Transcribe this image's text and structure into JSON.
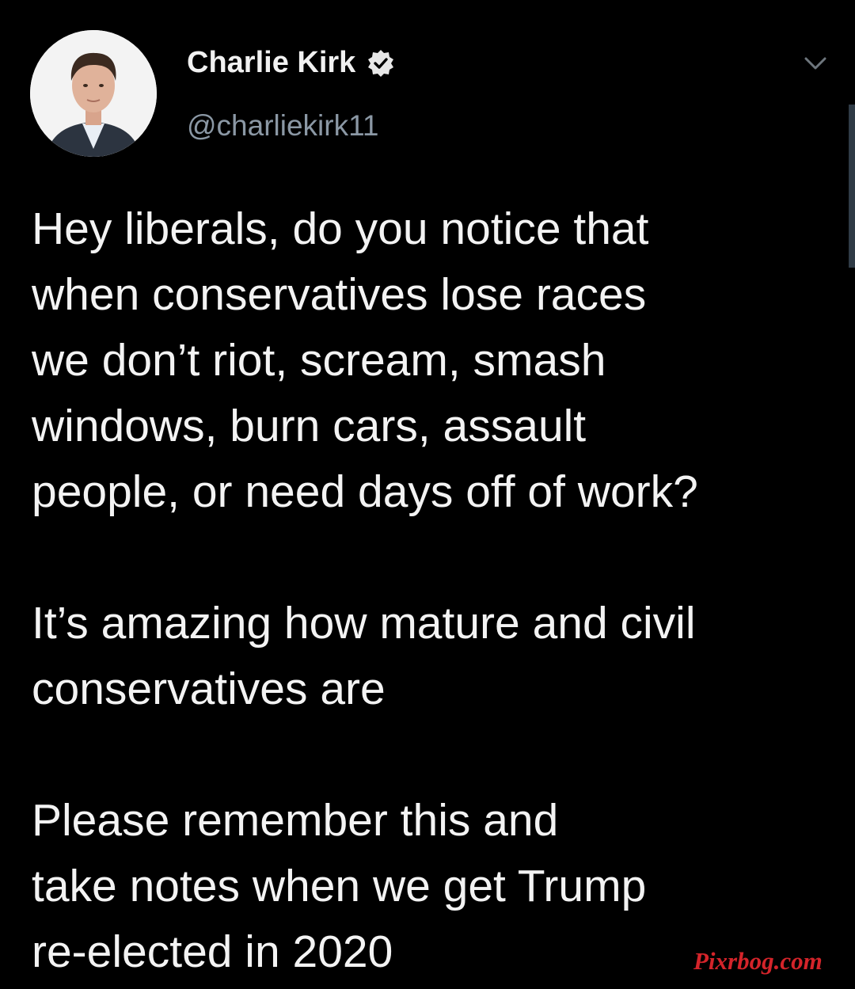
{
  "tweet": {
    "display_name": "Charlie Kirk",
    "handle": "@charliekirk11",
    "verified_icon": "verified-badge-icon",
    "menu_icon": "chevron-down-icon",
    "paragraphs": [
      "Hey liberals, do you notice that\nwhen conservatives lose races\nwe don’t riot, scream, smash\nwindows, burn cars, assault\npeople, or need days off of work?",
      "It’s amazing how mature and civil\nconservatives are",
      "Please remember this and\ntake notes when we get Trump\nre-elected in 2020"
    ]
  },
  "watermark": "Pixrbog.com",
  "colors": {
    "background": "#000000",
    "text": "#f3f3f3",
    "handle": "#8b98a5",
    "watermark": "#d4242a"
  }
}
